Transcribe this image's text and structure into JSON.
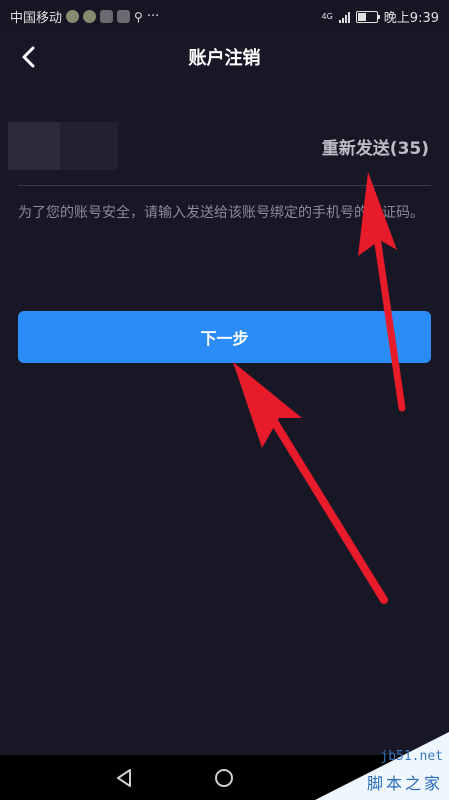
{
  "status_bar": {
    "carrier": "中国移动",
    "more": "···",
    "network": "4G",
    "time": "晚上9:39"
  },
  "header": {
    "title": "账户注销"
  },
  "verification": {
    "resend_label": "重新发送(35)",
    "hint": "为了您的账号安全，请输入发送给该账号绑定的手机号的验证码。"
  },
  "next_button": {
    "label": "下一步"
  },
  "watermark": {
    "url": "jb51.net",
    "name": "脚本之家"
  },
  "colors": {
    "background": "#171725",
    "accent": "#2b8cf7",
    "annotation_arrow": "#e81b2a"
  }
}
